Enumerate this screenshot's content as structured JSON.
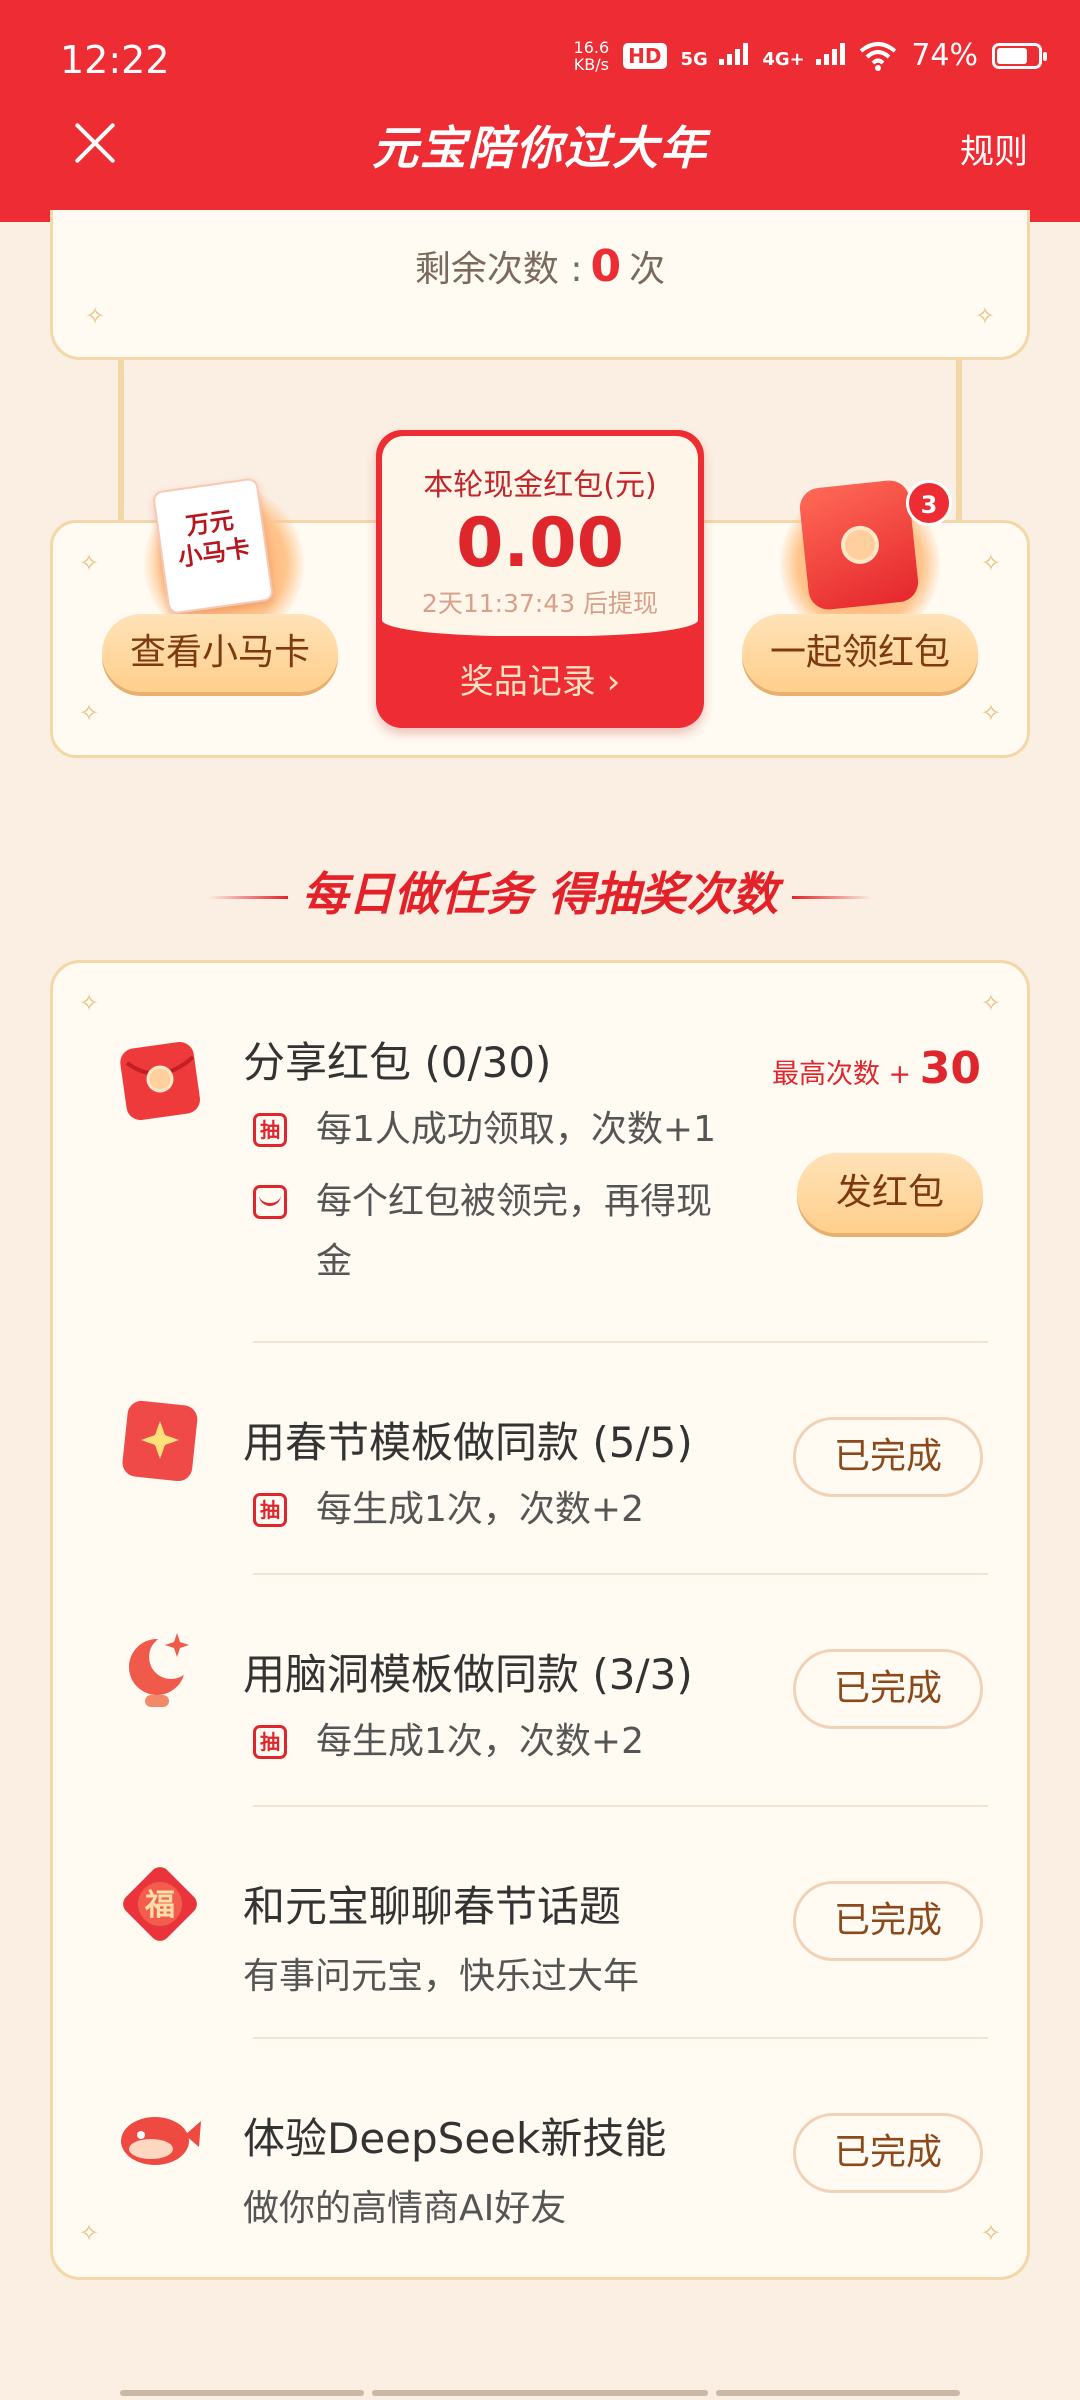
{
  "status_bar": {
    "time": "12:22",
    "net_speed_value": "16.6",
    "net_speed_unit": "KB/s",
    "hd": "HD",
    "net_5g": "5G",
    "net_4g": "4G+",
    "battery": "74%"
  },
  "header": {
    "title": "元宝陪你过大年",
    "rules": "规则"
  },
  "remaining": {
    "label": "剩余次数 :",
    "count": "0",
    "unit": "次"
  },
  "left_card": {
    "card_line1": "万元",
    "card_line2": "小马卡",
    "button": "查看小马卡"
  },
  "cash_panel": {
    "label": "本轮现金红包(元)",
    "value": "0.00",
    "timer": "2天11:37:43 后提现",
    "link": "奖品记录 ›"
  },
  "right_card": {
    "badge": "3",
    "button": "一起领红包"
  },
  "section": {
    "heading": "每日做任务  得抽奖次数"
  },
  "tasks": [
    {
      "title": "分享红包 (0/30)",
      "max_label": "最高次数 +",
      "max_value": "30",
      "sub1": "每1人成功领取，次数+1",
      "sub2_line1": "每个红包被领完，再得现",
      "sub2_line2": "金",
      "button": "发红包",
      "mark": "抽"
    },
    {
      "title": "用春节模板做同款 (5/5)",
      "sub1": "每生成1次，次数+2",
      "button": "已完成",
      "mark": "抽"
    },
    {
      "title": "用脑洞模板做同款 (3/3)",
      "sub1": "每生成1次，次数+2",
      "button": "已完成",
      "mark": "抽"
    },
    {
      "title": "和元宝聊聊春节话题",
      "sub1": "有事问元宝，快乐过大年",
      "button": "已完成",
      "icon_text": "福"
    },
    {
      "title": "体验DeepSeek新技能",
      "sub1": "做你的高情商AI好友",
      "button": "已完成"
    }
  ],
  "colors": {
    "brand_red": "#ee2c33",
    "background": "#fbeee2",
    "card": "#fffaf2",
    "gold_border": "#f3d7a6"
  }
}
